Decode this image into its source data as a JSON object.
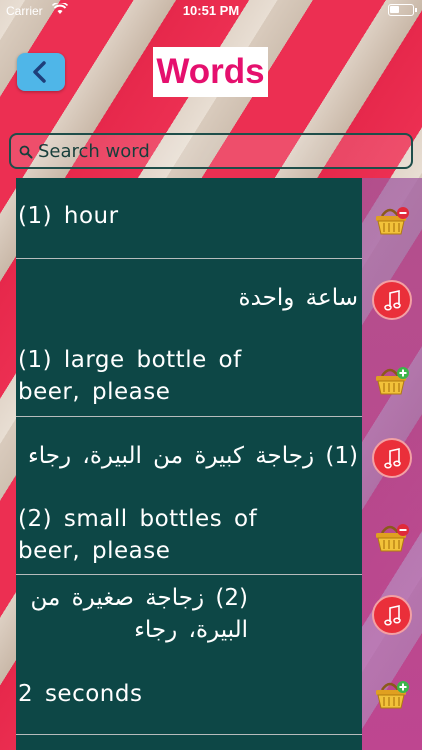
{
  "status_bar": {
    "carrier": "Carrier",
    "time": "10:51 PM"
  },
  "header": {
    "title": "Words"
  },
  "search": {
    "placeholder": "Search word"
  },
  "rows": [
    {
      "text": "(1)  hour",
      "dir": "ltr"
    },
    {
      "text": "ساعة واحدة",
      "dir": "rtl"
    },
    {
      "text": "(1)  large  bottle  of beer,  please",
      "dir": "ltr"
    },
    {
      "text": "(1)  زجاجة كبيرة من البيرة، رجاء",
      "dir": "rtl"
    },
    {
      "text": "(2)  small  bottles  of beer,  please",
      "dir": "ltr"
    },
    {
      "text": "(2)  زجاجة صغيرة من البيرة، رجاء",
      "dir": "rtl"
    },
    {
      "text": "2  seconds",
      "dir": "ltr"
    }
  ],
  "actions": [
    {
      "icon": "basket-remove-icon"
    },
    {
      "icon": "music-note-icon"
    },
    {
      "icon": "basket-add-icon"
    },
    {
      "icon": "music-note-icon"
    },
    {
      "icon": "basket-remove-icon"
    },
    {
      "icon": "music-note-icon"
    },
    {
      "icon": "basket-add-icon"
    }
  ],
  "colors": {
    "list_bg": "#0d4746",
    "title": "#e5106e",
    "back_button": "#4fb6e8",
    "music_button": "#ea2f3a"
  }
}
